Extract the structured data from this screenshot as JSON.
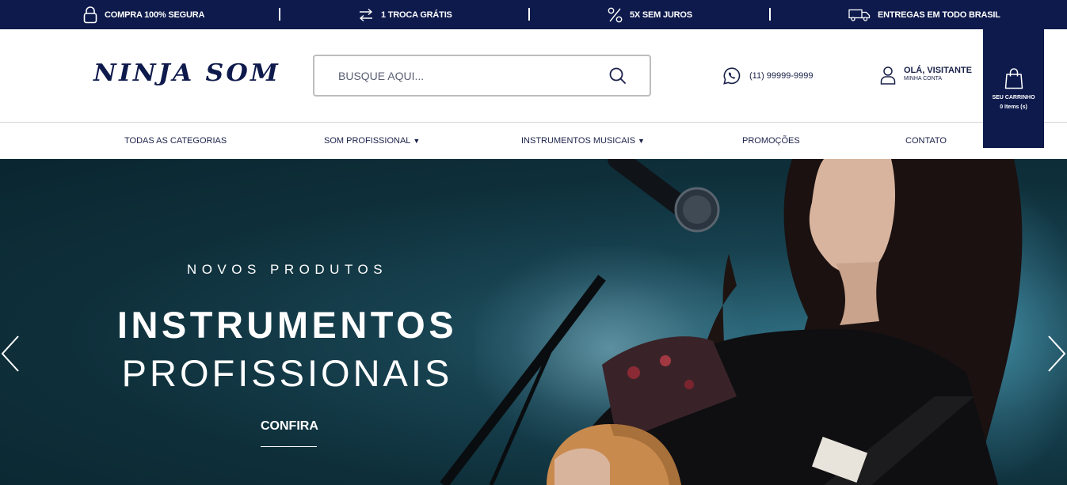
{
  "topbar": {
    "items": [
      {
        "label": "COMPRA 100% SEGURA",
        "icon": "padlock-icon"
      },
      {
        "label": "1 TROCA GRÁTIS",
        "icon": "exchange-arrows-icon"
      },
      {
        "label": "5X SEM JUROS",
        "icon": "percent-icon"
      },
      {
        "label": "ENTREGAS EM TODO BRASIL",
        "icon": "truck-icon"
      }
    ]
  },
  "header": {
    "logo": "NINJA SOM",
    "search_placeholder": "BUSQUE AQUI...",
    "phone": "(11) 99999-9999",
    "account_greeting": "OLÁ, VISITANTE",
    "account_link": "MINHA CONTA",
    "cart_label": "SEU CARRINHO",
    "cart_count": "0 Items (s)"
  },
  "nav": {
    "items": [
      {
        "label": "TODAS AS CATEGORIAS",
        "arrow": ""
      },
      {
        "label": "SOM PROFISSIONAL",
        "arrow": "▼"
      },
      {
        "label": "INSTRUMENTOS MUSICAIS",
        "arrow": "▼"
      },
      {
        "label": "PROMOÇÕES",
        "arrow": ""
      },
      {
        "label": "CONTATO",
        "arrow": ""
      }
    ]
  },
  "hero": {
    "kicker": "NOVOS PRODUTOS",
    "title_line1": "INSTRUMENTOS",
    "title_line2": "PROFISSIONAIS",
    "cta": "CONFIRA"
  },
  "colors": {
    "brand_navy": "#0e1a4c",
    "hero_teal": "#17414f",
    "text_dark": "#1a2149"
  }
}
